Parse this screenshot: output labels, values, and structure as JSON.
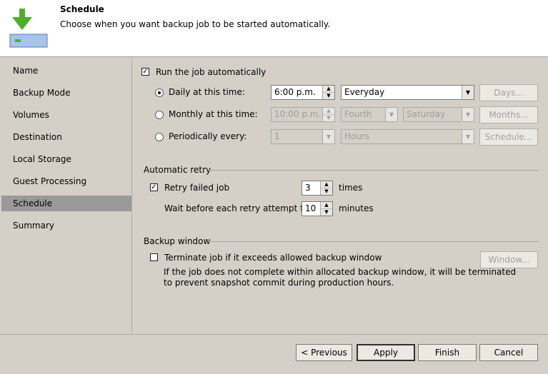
{
  "header": {
    "title": "Schedule",
    "subtitle": "Choose when you want backup job to be started automatically."
  },
  "sidebar": {
    "items": [
      {
        "label": "Name",
        "active": false
      },
      {
        "label": "Backup Mode",
        "active": false
      },
      {
        "label": "Volumes",
        "active": false
      },
      {
        "label": "Destination",
        "active": false
      },
      {
        "label": "Local Storage",
        "active": false
      },
      {
        "label": "Guest Processing",
        "active": false
      },
      {
        "label": "Schedule",
        "active": true
      },
      {
        "label": "Summary",
        "active": false
      }
    ]
  },
  "schedule": {
    "run_auto_label": "Run the job automatically",
    "run_auto_checked": true,
    "daily": {
      "label": "Daily at this time:",
      "time": "6:00 p.m.",
      "days": "Everyday",
      "button": "Days...",
      "selected": true
    },
    "monthly": {
      "label": "Monthly at this time:",
      "time": "10:00 p.m.",
      "week": "Fourth",
      "day": "Saturday",
      "button": "Months...",
      "selected": false
    },
    "periodic": {
      "label": "Periodically every:",
      "value": "1",
      "unit": "Hours",
      "button": "Schedule...",
      "selected": false
    }
  },
  "retry": {
    "section_label": "Automatic retry",
    "retry_label": "Retry failed job",
    "retry_checked": true,
    "retry_count": "3",
    "retry_unit": "times",
    "wait_label": "Wait before each retry attempt for:",
    "wait_value": "10",
    "wait_unit": "minutes"
  },
  "backup_window": {
    "section_label": "Backup window",
    "terminate_label": "Terminate job if it exceeds allowed backup window",
    "terminate_checked": false,
    "description_line1": "If the job does not complete within allocated backup window, it will be terminated",
    "description_line2": "to prevent snapshot commit during production hours.",
    "button": "Window..."
  },
  "footer": {
    "previous": "< Previous",
    "apply": "Apply",
    "finish": "Finish",
    "cancel": "Cancel"
  },
  "colors": {
    "arrow_green": "#4caf2a",
    "selected_nav": "#9a9a9a"
  }
}
